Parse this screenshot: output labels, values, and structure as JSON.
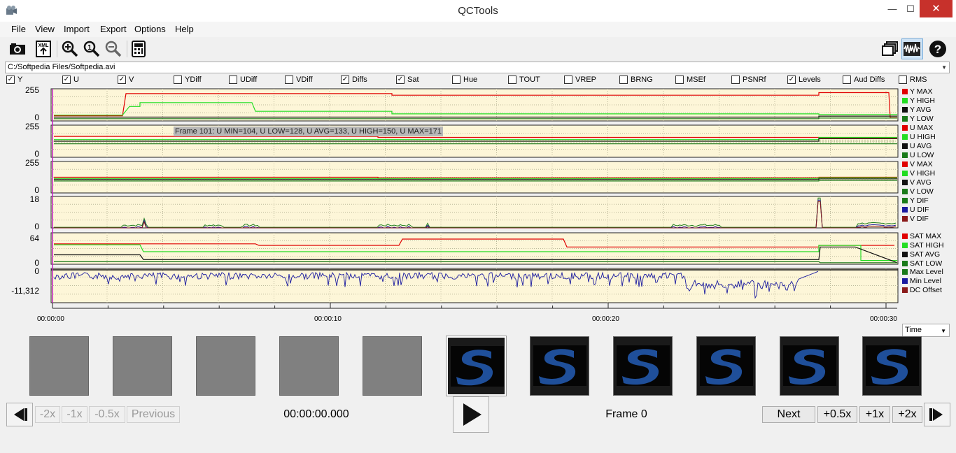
{
  "window": {
    "title": "QCTools"
  },
  "menu": [
    "File",
    "View",
    "Import",
    "Export",
    "Options",
    "Help"
  ],
  "toolbar": {
    "left_icons": [
      "open-file-icon",
      "xml-export-icon",
      "zoom-in-icon",
      "zoom-reset-icon",
      "zoom-out-icon",
      "settings-grid-icon"
    ],
    "right_icons": [
      "windows-icon",
      "waveform-icon",
      "help-icon"
    ]
  },
  "file": {
    "path": "C:/Softpedia Files/Softpedia.avi"
  },
  "filters": [
    {
      "label": "Y",
      "checked": true
    },
    {
      "label": "U",
      "checked": true
    },
    {
      "label": "V",
      "checked": true
    },
    {
      "label": "YDiff",
      "checked": false
    },
    {
      "label": "UDiff",
      "checked": false
    },
    {
      "label": "VDiff",
      "checked": false
    },
    {
      "label": "Diffs",
      "checked": true
    },
    {
      "label": "Sat",
      "checked": true
    },
    {
      "label": "Hue",
      "checked": false
    },
    {
      "label": "TOUT",
      "checked": false
    },
    {
      "label": "VREP",
      "checked": false
    },
    {
      "label": "BRNG",
      "checked": false
    },
    {
      "label": "MSEf",
      "checked": false
    },
    {
      "label": "PSNRf",
      "checked": false
    },
    {
      "label": "Levels",
      "checked": true
    },
    {
      "label": "Aud Diffs",
      "checked": false
    },
    {
      "label": "RMS",
      "checked": false
    }
  ],
  "plots": [
    {
      "ymax": "255",
      "ymin": "0",
      "legend": [
        {
          "name": "Y MAX",
          "color": "#e00000"
        },
        {
          "name": "Y HIGH",
          "color": "#22dd22"
        },
        {
          "name": "Y AVG",
          "color": "#111111"
        },
        {
          "name": "Y LOW",
          "color": "#1a7a1a"
        }
      ]
    },
    {
      "ymax": "255",
      "ymin": "0",
      "legend": [
        {
          "name": "U MAX",
          "color": "#e00000"
        },
        {
          "name": "U HIGH",
          "color": "#22dd22"
        },
        {
          "name": "U AVG",
          "color": "#111111"
        },
        {
          "name": "U LOW",
          "color": "#1a7a1a"
        }
      ]
    },
    {
      "ymax": "255",
      "ymin": "0",
      "legend": [
        {
          "name": "V MAX",
          "color": "#e00000"
        },
        {
          "name": "V HIGH",
          "color": "#22dd22"
        },
        {
          "name": "V AVG",
          "color": "#111111"
        },
        {
          "name": "V LOW",
          "color": "#1a7a1a"
        }
      ]
    },
    {
      "ymax": "18",
      "ymin": "0",
      "legend": [
        {
          "name": "Y DIF",
          "color": "#1a7a1a"
        },
        {
          "name": "U DIF",
          "color": "#1a1aa0"
        },
        {
          "name": "V DIF",
          "color": "#8a1a1a"
        }
      ]
    },
    {
      "ymax": "64",
      "ymin": "0",
      "legend": [
        {
          "name": "SAT MAX",
          "color": "#e00000"
        },
        {
          "name": "SAT HIGH",
          "color": "#22dd22"
        },
        {
          "name": "SAT AVG",
          "color": "#111111"
        },
        {
          "name": "SAT LOW",
          "color": "#1a7a1a"
        }
      ]
    },
    {
      "ymax": "0",
      "ymin": "-11,312",
      "legend": [
        {
          "name": "Max Level",
          "color": "#1a7a1a"
        },
        {
          "name": "Min Level",
          "color": "#1a1aa0"
        },
        {
          "name": "DC Offset",
          "color": "#8a1a1a"
        }
      ]
    }
  ],
  "tooltip": "Frame 101: U MIN=104, U LOW=128, U AVG=133, U HIGH=150, U MAX=171",
  "timeline": [
    "00:00:00",
    "00:00:10",
    "00:00:20",
    "00:00:30"
  ],
  "time_mode": "Time",
  "controls": {
    "rewind": [
      "-2x",
      "-1x",
      "-0.5x",
      "Previous"
    ],
    "timecode": "00:00:00.000",
    "frame": "Frame 0",
    "forward": [
      "Next",
      "+0.5x",
      "+1x",
      "+2x"
    ]
  }
}
